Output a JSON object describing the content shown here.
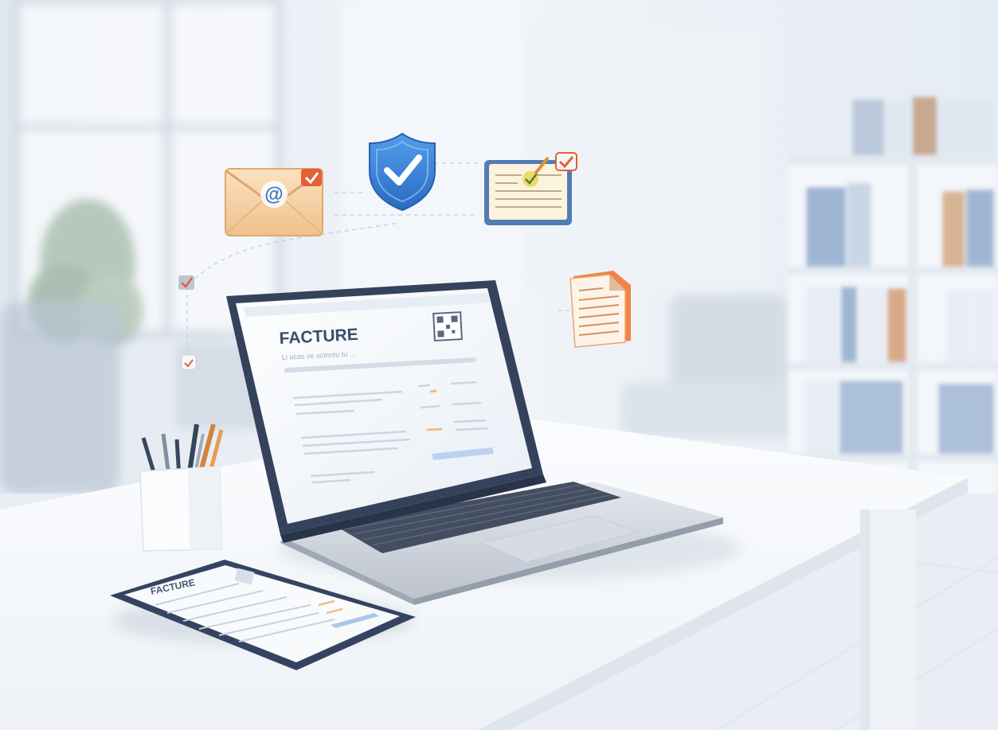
{
  "laptop_screen": {
    "document_title": "FACTURE",
    "document_subtitle": "Li ucas ve ucmntu tu ..."
  },
  "tablet_screen": {
    "document_title": "FACTURE"
  },
  "icons": {
    "email": "email-at-icon",
    "shield": "shield-check-icon",
    "approved_document": "approved-document-icon",
    "document": "document-icon",
    "small_check": "small-check-icon"
  },
  "colors": {
    "shield_blue": "#2f7fd8",
    "envelope_orange": "#f4c590",
    "badge_red": "#e4572e",
    "doc_orange": "#ef7e3a"
  }
}
